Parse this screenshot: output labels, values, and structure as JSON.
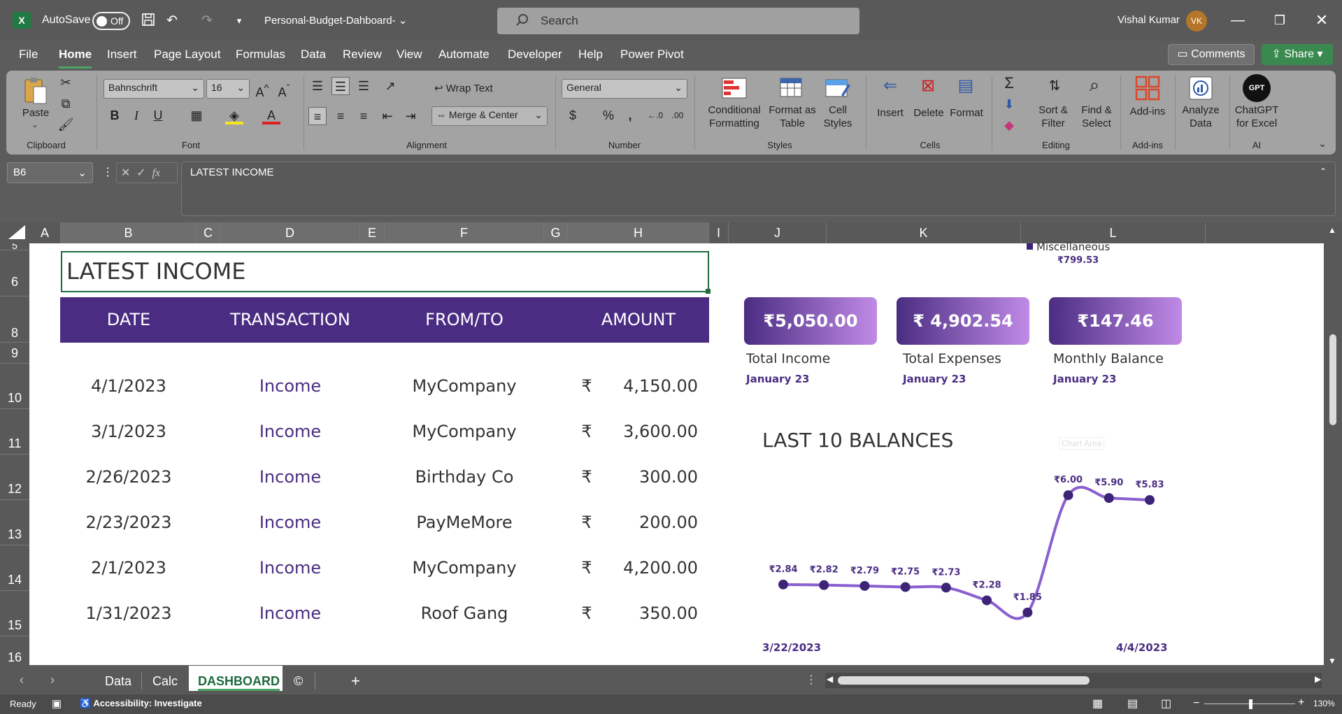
{
  "window": {
    "autosave_label": "AutoSave",
    "autosave_state": "Off",
    "doc_title": "Personal-Budget-Dahboard-",
    "search_placeholder": "Search",
    "user_name": "Vishal Kumar",
    "user_initials": "VK"
  },
  "menu": {
    "tabs": [
      "File",
      "Home",
      "Insert",
      "Page Layout",
      "Formulas",
      "Data",
      "Review",
      "View",
      "Automate",
      "Developer",
      "Help",
      "Power Pivot"
    ],
    "active": "Home",
    "comments_label": "Comments",
    "share_label": "Share"
  },
  "ribbon": {
    "clipboard": {
      "paste": "Paste",
      "group": "Clipboard"
    },
    "font": {
      "name": "Bahnschrift",
      "size": "16",
      "group": "Font"
    },
    "alignment": {
      "wrap_text": "Wrap Text",
      "merge_center": "Merge & Center",
      "group": "Alignment"
    },
    "number": {
      "format": "General",
      "group": "Number"
    },
    "styles": {
      "conditional": "Conditional Formatting",
      "format_table": "Format as Table",
      "cell_styles": "Cell Styles",
      "group": "Styles"
    },
    "cells": {
      "insert": "Insert",
      "delete": "Delete",
      "format": "Format",
      "group": "Cells"
    },
    "editing": {
      "sort_filter": "Sort & Filter",
      "find_select": "Find & Select",
      "group": "Editing"
    },
    "addins": {
      "label": "Add-ins",
      "group": "Add-ins"
    },
    "analyze": {
      "label": "Analyze Data"
    },
    "ai": {
      "label": "ChatGPT for Excel",
      "group": "AI",
      "logo_text": "GPT"
    }
  },
  "formula_bar": {
    "name_box": "B6",
    "content": "LATEST INCOME"
  },
  "columns": [
    "A",
    "B",
    "C",
    "D",
    "E",
    "F",
    "G",
    "H",
    "I",
    "J",
    "K",
    "L"
  ],
  "rows": [
    "5",
    "6",
    "8",
    "9",
    "10",
    "11",
    "12",
    "13",
    "14",
    "15",
    "16"
  ],
  "sheet": {
    "title": "LATEST INCOME",
    "headers": [
      "DATE",
      "TRANSACTION",
      "FROM/TO",
      "AMOUNT"
    ],
    "currency": "₹",
    "income_rows": [
      {
        "date": "4/1/2023",
        "type": "Income",
        "from": "MyCompany",
        "amount": "4,150.00"
      },
      {
        "date": "3/1/2023",
        "type": "Income",
        "from": "MyCompany",
        "amount": "3,600.00"
      },
      {
        "date": "2/26/2023",
        "type": "Income",
        "from": "Birthday Co",
        "amount": "300.00"
      },
      {
        "date": "2/23/2023",
        "type": "Income",
        "from": "PayMeMore",
        "amount": "200.00"
      },
      {
        "date": "2/1/2023",
        "type": "Income",
        "from": "MyCompany",
        "amount": "4,200.00"
      },
      {
        "date": "1/31/2023",
        "type": "Income",
        "from": "Roof Gang",
        "amount": "350.00"
      }
    ],
    "legend_item": "Miscellaneous",
    "legend_value": "₹799.53",
    "cards": [
      {
        "value": "₹5,050.00",
        "label": "Total Income",
        "sub": "January 23"
      },
      {
        "value": "₹ 4,902.54",
        "label": "Total Expenses",
        "sub": "January 23"
      },
      {
        "value": "₹147.46",
        "label": "Monthly Balance",
        "sub": "January 23"
      }
    ],
    "chart_area_hint": "Chart Area"
  },
  "chart_data": {
    "type": "line",
    "title": "LAST 10 BALANCES",
    "values": [
      2.84,
      2.82,
      2.79,
      2.75,
      2.73,
      2.28,
      1.85,
      6.0,
      5.9,
      5.83
    ],
    "labels": [
      "₹2.84",
      "₹2.82",
      "₹2.79",
      "₹2.75",
      "₹2.73",
      "₹2.28",
      "₹1.85",
      "₹6.00",
      "₹5.90",
      "₹5.83"
    ],
    "x_start": "3/22/2023",
    "x_end": "4/4/2023",
    "ylim": [
      1.5,
      6.2
    ],
    "color": "#8a5fd0",
    "marker_color": "#3e2479"
  },
  "sheet_tabs": [
    "Data",
    "Calc",
    "DASHBOARD",
    "©"
  ],
  "active_sheet": "DASHBOARD",
  "status": {
    "ready": "Ready",
    "accessibility": "Accessibility: Investigate",
    "zoom": "130%"
  },
  "colors": {
    "accent_purple": "#4a2d82",
    "excel_green": "#1e6b3c"
  }
}
